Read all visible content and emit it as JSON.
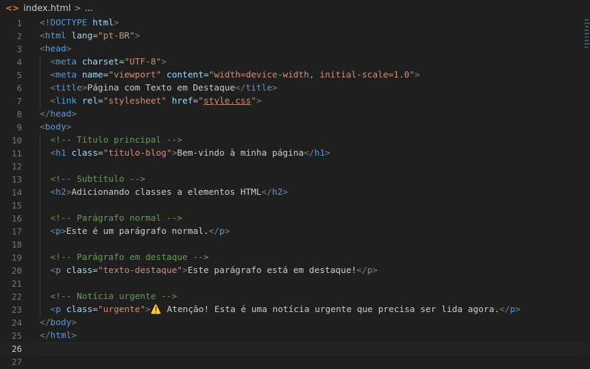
{
  "breadcrumb": {
    "file": "index.html",
    "separator": ">",
    "more": "..."
  },
  "editor": {
    "current_line": 26,
    "lines": [
      {
        "n": "1",
        "tokens": [
          [
            "b",
            "<!"
          ],
          [
            "t",
            "DOCTYPE"
          ],
          [
            "p",
            " "
          ],
          [
            "a",
            "html"
          ],
          [
            "b",
            ">"
          ]
        ]
      },
      {
        "n": "2",
        "tokens": [
          [
            "b",
            "<"
          ],
          [
            "t",
            "html"
          ],
          [
            "p",
            " "
          ],
          [
            "a",
            "lang"
          ],
          [
            "p",
            "="
          ],
          [
            "s",
            "\"pt-BR\""
          ],
          [
            "b",
            ">"
          ]
        ]
      },
      {
        "n": "3",
        "tokens": [
          [
            "b",
            "<"
          ],
          [
            "t",
            "head"
          ],
          [
            "b",
            ">"
          ]
        ]
      },
      {
        "n": "4",
        "tokens": [
          [
            "p",
            "  "
          ],
          [
            "b",
            "<"
          ],
          [
            "t",
            "meta"
          ],
          [
            "p",
            " "
          ],
          [
            "a",
            "charset"
          ],
          [
            "p",
            "="
          ],
          [
            "s",
            "\"UTF-8\""
          ],
          [
            "b",
            ">"
          ]
        ]
      },
      {
        "n": "5",
        "tokens": [
          [
            "p",
            "  "
          ],
          [
            "b",
            "<"
          ],
          [
            "t",
            "meta"
          ],
          [
            "p",
            " "
          ],
          [
            "a",
            "name"
          ],
          [
            "p",
            "="
          ],
          [
            "s",
            "\"viewport\""
          ],
          [
            "p",
            " "
          ],
          [
            "a",
            "content"
          ],
          [
            "p",
            "="
          ],
          [
            "s",
            "\"width=device-width, initial-scale=1.0\""
          ],
          [
            "b",
            ">"
          ]
        ]
      },
      {
        "n": "6",
        "tokens": [
          [
            "p",
            "  "
          ],
          [
            "b",
            "<"
          ],
          [
            "t",
            "title"
          ],
          [
            "b",
            ">"
          ],
          [
            "p",
            "Página com Texto em Destaque"
          ],
          [
            "b",
            "</"
          ],
          [
            "t",
            "title"
          ],
          [
            "b",
            ">"
          ]
        ]
      },
      {
        "n": "7",
        "tokens": [
          [
            "p",
            "  "
          ],
          [
            "b",
            "<"
          ],
          [
            "t",
            "link"
          ],
          [
            "p",
            " "
          ],
          [
            "a",
            "rel"
          ],
          [
            "p",
            "="
          ],
          [
            "s",
            "\"stylesheet\""
          ],
          [
            "p",
            " "
          ],
          [
            "a",
            "href"
          ],
          [
            "p",
            "="
          ],
          [
            "s",
            "\""
          ],
          [
            "u",
            "style.css"
          ],
          [
            "s",
            "\""
          ],
          [
            "b",
            ">"
          ]
        ]
      },
      {
        "n": "8",
        "tokens": [
          [
            "b",
            "</"
          ],
          [
            "t",
            "head"
          ],
          [
            "b",
            ">"
          ]
        ]
      },
      {
        "n": "9",
        "tokens": [
          [
            "b",
            "<"
          ],
          [
            "t",
            "body"
          ],
          [
            "b",
            ">"
          ]
        ]
      },
      {
        "n": "10",
        "tokens": [
          [
            "p",
            "  "
          ],
          [
            "c",
            "<!-- Título principal -->"
          ]
        ]
      },
      {
        "n": "11",
        "tokens": [
          [
            "p",
            "  "
          ],
          [
            "b",
            "<"
          ],
          [
            "t",
            "h1"
          ],
          [
            "p",
            " "
          ],
          [
            "a",
            "class"
          ],
          [
            "p",
            "="
          ],
          [
            "s",
            "\"titulo-blog\""
          ],
          [
            "b",
            ">"
          ],
          [
            "p",
            "Bem-vindo à minha página"
          ],
          [
            "b",
            "</"
          ],
          [
            "t",
            "h1"
          ],
          [
            "b",
            ">"
          ]
        ]
      },
      {
        "n": "12",
        "tokens": []
      },
      {
        "n": "13",
        "tokens": [
          [
            "p",
            "  "
          ],
          [
            "c",
            "<!-- Subtítulo -->"
          ]
        ]
      },
      {
        "n": "14",
        "tokens": [
          [
            "p",
            "  "
          ],
          [
            "b",
            "<"
          ],
          [
            "t",
            "h2"
          ],
          [
            "b",
            ">"
          ],
          [
            "p",
            "Adicionando classes a elementos HTML"
          ],
          [
            "b",
            "</"
          ],
          [
            "t",
            "h2"
          ],
          [
            "b",
            ">"
          ]
        ]
      },
      {
        "n": "15",
        "tokens": []
      },
      {
        "n": "16",
        "tokens": [
          [
            "p",
            "  "
          ],
          [
            "c",
            "<!-- Parágrafo normal -->"
          ]
        ]
      },
      {
        "n": "17",
        "tokens": [
          [
            "p",
            "  "
          ],
          [
            "b",
            "<"
          ],
          [
            "t",
            "p"
          ],
          [
            "b",
            ">"
          ],
          [
            "p",
            "Este é um parágrafo normal."
          ],
          [
            "b",
            "</"
          ],
          [
            "t",
            "p"
          ],
          [
            "b",
            ">"
          ]
        ]
      },
      {
        "n": "18",
        "tokens": []
      },
      {
        "n": "19",
        "tokens": [
          [
            "p",
            "  "
          ],
          [
            "c",
            "<!-- Parágrafo em destaque -->"
          ]
        ]
      },
      {
        "n": "20",
        "tokens": [
          [
            "p",
            "  "
          ],
          [
            "b",
            "<"
          ],
          [
            "t",
            "p"
          ],
          [
            "p",
            " "
          ],
          [
            "a",
            "class"
          ],
          [
            "p",
            "="
          ],
          [
            "s",
            "\"texto-destaque\""
          ],
          [
            "b",
            ">"
          ],
          [
            "p",
            "Este parágrafo está em destaque!"
          ],
          [
            "b",
            "</"
          ],
          [
            "t",
            "p"
          ],
          [
            "b",
            ">"
          ]
        ]
      },
      {
        "n": "21",
        "tokens": []
      },
      {
        "n": "22",
        "tokens": [
          [
            "p",
            "  "
          ],
          [
            "c",
            "<!-- Notícia urgente -->"
          ]
        ]
      },
      {
        "n": "23",
        "tokens": [
          [
            "p",
            "  "
          ],
          [
            "b",
            "<"
          ],
          [
            "t",
            "p"
          ],
          [
            "p",
            " "
          ],
          [
            "a",
            "class"
          ],
          [
            "p",
            "="
          ],
          [
            "s",
            "\"urgente\""
          ],
          [
            "b",
            ">"
          ],
          [
            "w",
            "⚠️"
          ],
          [
            "p",
            " Atenção! Esta é uma notícia urgente que precisa ser lida agora."
          ],
          [
            "b",
            "</"
          ],
          [
            "t",
            "p"
          ],
          [
            "b",
            ">"
          ]
        ]
      },
      {
        "n": "24",
        "tokens": [
          [
            "b",
            "</"
          ],
          [
            "t",
            "body"
          ],
          [
            "b",
            ">"
          ]
        ]
      },
      {
        "n": "25",
        "tokens": [
          [
            "b",
            "</"
          ],
          [
            "t",
            "html"
          ],
          [
            "b",
            ">"
          ]
        ]
      },
      {
        "n": "26",
        "tokens": []
      },
      {
        "n": "27",
        "tokens": []
      }
    ]
  }
}
